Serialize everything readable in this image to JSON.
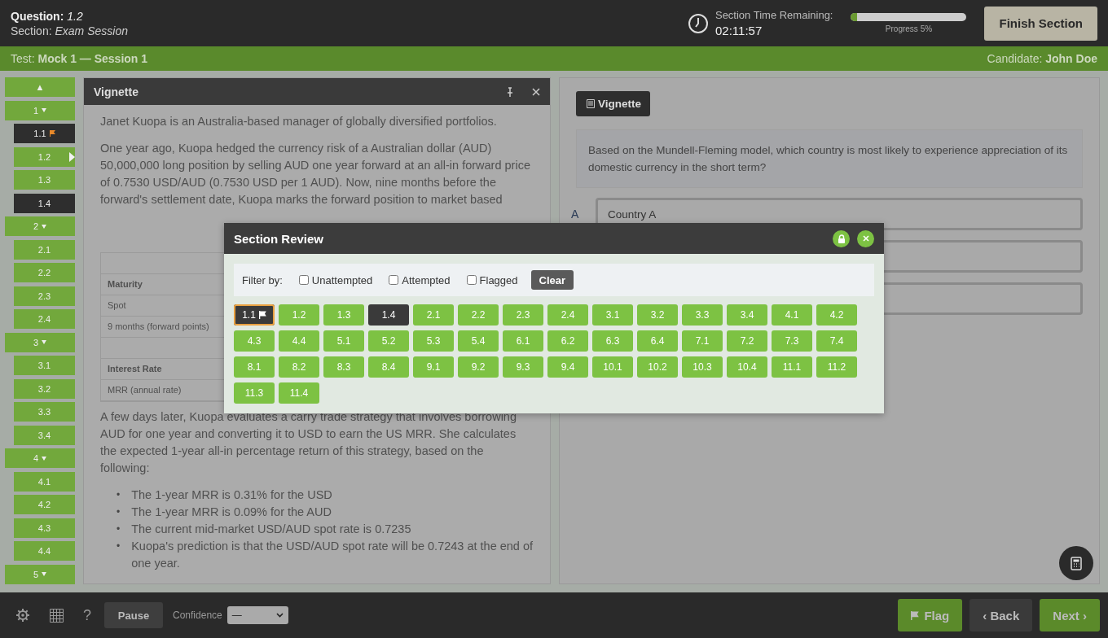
{
  "header": {
    "question": "**Question:** *1.2*",
    "section": "Section: *Exam Session*",
    "timer_label": "Section Time Remaining:",
    "timer_value": "02:11:57",
    "progress": {
      "level": 0.05,
      "label": "Progress 5%"
    },
    "finish_button": "Finish Section"
  },
  "test_bar": {
    "test": "Test: **Mock 1 — Session 1**",
    "candidate": "Candidate: **John Doe**"
  },
  "sidebar": {
    "scroll_up": "▲",
    "groups": [
      {
        "label": "1",
        "expanded": true,
        "children": [
          {
            "label": "1.1",
            "attempted": true,
            "flagged": true,
            "selected": false
          },
          {
            "label": "1.2",
            "attempted": false,
            "flagged": false,
            "selected": true
          },
          {
            "label": "1.3",
            "attempted": false,
            "flagged": false,
            "selected": false
          },
          {
            "label": "1.4",
            "attempted": true,
            "flagged": false,
            "selected": false
          }
        ]
      },
      {
        "label": "2",
        "expanded": true,
        "children": [
          {
            "label": "2.1",
            "attempted": false,
            "flagged": false,
            "selected": false
          },
          {
            "label": "2.2",
            "attempted": false,
            "flagged": false,
            "selected": false
          },
          {
            "label": "2.3",
            "attempted": false,
            "flagged": false,
            "selected": false
          },
          {
            "label": "2.4",
            "attempted": false,
            "flagged": false,
            "selected": false
          }
        ]
      },
      {
        "label": "3",
        "expanded": true,
        "children": [
          {
            "label": "3.1",
            "attempted": false,
            "flagged": false,
            "selected": false
          },
          {
            "label": "3.2",
            "attempted": false,
            "flagged": false,
            "selected": false
          },
          {
            "label": "3.3",
            "attempted": false,
            "flagged": false,
            "selected": false
          },
          {
            "label": "3.4",
            "attempted": false,
            "flagged": false,
            "selected": false
          }
        ]
      },
      {
        "label": "4",
        "expanded": true,
        "children": [
          {
            "label": "4.1",
            "attempted": false,
            "flagged": false,
            "selected": false
          },
          {
            "label": "4.2",
            "attempted": false,
            "flagged": false,
            "selected": false
          },
          {
            "label": "4.3",
            "attempted": false,
            "flagged": false,
            "selected": false
          },
          {
            "label": "4.4",
            "attempted": false,
            "flagged": false,
            "selected": false
          }
        ]
      },
      {
        "label": "5",
        "expanded": true
      }
    ]
  },
  "vignette_panel": {
    "title": "Vignette",
    "intro": "Janet Kuopa is an Australia-based manager of globally diversified portfolios.",
    "paragraph": "One year ago, Kuopa hedged the currency risk of a Australian dollar (AUD) 50,000,000 long position by selling AUD one year forward at an all-in forward price of 0.7530 USD/AUD (0.7530 USD per 1 AUD). Now, nine months before the forward's settlement date, Kuopa marks the forward position to market based",
    "table_rows": [
      {
        "kind": "blank"
      },
      {
        "kind": "heading",
        "text": "Maturity"
      },
      {
        "kind": "row",
        "text": "Spot"
      },
      {
        "kind": "row",
        "text": "9 months (forward points)"
      },
      {
        "kind": "blank"
      },
      {
        "kind": "heading",
        "text": "Interest Rate"
      },
      {
        "kind": "row",
        "text": "MRR (annual rate)"
      }
    ],
    "paragraph_2": "A few days later, Kuopa evaluates a carry trade strategy that involves borrowing AUD for one year and converting it to USD to earn the US MRR. She calculates the expected 1-year all-in percentage return of this strategy, based on the following:",
    "bullets": [
      {
        "marker": "•",
        "text": "The 1-year MRR is 0.31% for the USD"
      },
      {
        "marker": "•",
        "text": "The 1-year MRR is 0.09% for the AUD"
      },
      {
        "marker": "•",
        "text": "The current mid-market USD/AUD spot rate is 0.7235"
      },
      {
        "marker": "•",
        "text": "Kuopa's prediction is that the USD/AUD spot rate will be 0.7243 at the end of one year."
      }
    ]
  },
  "question_panel": {
    "vignette_button": "Vignette",
    "question": "Based on the Mundell-Fleming model, which country is most likely to experience appreciation of its domestic currency in the short term?",
    "options": [
      {
        "kind": "answer",
        "letter": "A",
        "text": "Country A"
      },
      {
        "kind": "blank"
      },
      {
        "kind": "blank"
      }
    ]
  },
  "modal": {
    "title": "Section Review",
    "filter_label": "Filter by:",
    "filters": [
      {
        "label": "Unattempted",
        "checked": false
      },
      {
        "label": "Attempted",
        "checked": false
      },
      {
        "label": "Flagged",
        "checked": false
      }
    ],
    "clear_button": "Clear",
    "questions": [
      {
        "label": "1.1",
        "attempted": true,
        "flagged": true
      },
      {
        "label": "1.2",
        "attempted": false,
        "flagged": false
      },
      {
        "label": "1.3",
        "attempted": false,
        "flagged": false
      },
      {
        "label": "1.4",
        "attempted": true,
        "flagged": false
      },
      {
        "label": "2.1",
        "attempted": false,
        "flagged": false
      },
      {
        "label": "2.2",
        "attempted": false,
        "flagged": false
      },
      {
        "label": "2.3",
        "attempted": false,
        "flagged": false
      },
      {
        "label": "2.4",
        "attempted": false,
        "flagged": false
      },
      {
        "label": "3.1",
        "attempted": false,
        "flagged": false
      },
      {
        "label": "3.2",
        "attempted": false,
        "flagged": false
      },
      {
        "label": "3.3",
        "attempted": false,
        "flagged": false
      },
      {
        "label": "3.4",
        "attempted": false,
        "flagged": false
      },
      {
        "label": "4.1",
        "attempted": false,
        "flagged": false
      },
      {
        "label": "4.2",
        "attempted": false,
        "flagged": false
      },
      {
        "label": "4.3",
        "attempted": false,
        "flagged": false
      },
      {
        "label": "4.4",
        "attempted": false,
        "flagged": false
      },
      {
        "label": "5.1",
        "attempted": false,
        "flagged": false
      },
      {
        "label": "5.2",
        "attempted": false,
        "flagged": false
      },
      {
        "label": "5.3",
        "attempted": false,
        "flagged": false
      },
      {
        "label": "5.4",
        "attempted": false,
        "flagged": false
      },
      {
        "label": "6.1",
        "attempted": false,
        "flagged": false
      },
      {
        "label": "6.2",
        "attempted": false,
        "flagged": false
      },
      {
        "label": "6.3",
        "attempted": false,
        "flagged": false
      },
      {
        "label": "6.4",
        "attempted": false,
        "flagged": false
      },
      {
        "label": "7.1",
        "attempted": false,
        "flagged": false
      },
      {
        "label": "7.2",
        "attempted": false,
        "flagged": false
      },
      {
        "label": "7.3",
        "attempted": false,
        "flagged": false
      },
      {
        "label": "7.4",
        "attempted": false,
        "flagged": false
      },
      {
        "label": "8.1",
        "attempted": false,
        "flagged": false
      },
      {
        "label": "8.2",
        "attempted": false,
        "flagged": false
      },
      {
        "label": "8.3",
        "attempted": false,
        "flagged": false
      },
      {
        "label": "8.4",
        "attempted": false,
        "flagged": false
      },
      {
        "label": "9.1",
        "attempted": false,
        "flagged": false
      },
      {
        "label": "9.2",
        "attempted": false,
        "flagged": false
      },
      {
        "label": "9.3",
        "attempted": false,
        "flagged": false
      },
      {
        "label": "9.4",
        "attempted": false,
        "flagged": false
      },
      {
        "label": "10.1",
        "attempted": false,
        "flagged": false
      },
      {
        "label": "10.2",
        "attempted": false,
        "flagged": false
      },
      {
        "label": "10.3",
        "attempted": false,
        "flagged": false
      },
      {
        "label": "10.4",
        "attempted": false,
        "flagged": false
      },
      {
        "label": "11.1",
        "attempted": false,
        "flagged": false
      },
      {
        "label": "11.2",
        "attempted": false,
        "flagged": false
      },
      {
        "label": "11.3",
        "attempted": false,
        "flagged": false
      },
      {
        "label": "11.4",
        "attempted": false,
        "flagged": false
      }
    ]
  },
  "footer": {
    "help": "?",
    "pause_button": "Pause",
    "confidence_label": "Confidence",
    "confidence_value": "—",
    "flag_button": "Flag",
    "back_button": "‹ Back",
    "next_button": "Next ›"
  }
}
